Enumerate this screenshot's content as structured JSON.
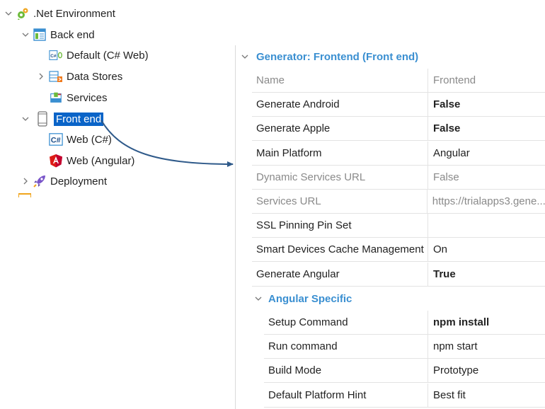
{
  "tree": {
    "root": {
      "label": ".Net Environment",
      "icon": "gears-icon"
    },
    "backend": {
      "label": "Back end",
      "icon": "window-app-icon"
    },
    "default_web": {
      "label": "Default (C# Web)",
      "icon": "csharp-web-icon"
    },
    "data_stores": {
      "label": "Data Stores",
      "icon": "data-stores-icon"
    },
    "services": {
      "label": "Services",
      "icon": "services-icon"
    },
    "frontend": {
      "label": "Front end",
      "icon": "mobile-device-icon"
    },
    "web_csharp": {
      "label": "Web (C#)",
      "icon": "csharp-icon"
    },
    "web_angular": {
      "label": "Web (Angular)",
      "icon": "angular-icon"
    },
    "deployment": {
      "label": "Deployment",
      "icon": "rocket-icon"
    }
  },
  "properties": {
    "category": "Generator: Frontend (Front end)",
    "rows": [
      {
        "name": "Name",
        "value": "Frontend",
        "disabled": true,
        "bold": false
      },
      {
        "name": "Generate Android",
        "value": "False",
        "disabled": false,
        "bold": true
      },
      {
        "name": "Generate Apple",
        "value": "False",
        "disabled": false,
        "bold": true
      },
      {
        "name": "Main Platform",
        "value": "Angular",
        "disabled": false,
        "bold": false
      },
      {
        "name": "Dynamic Services URL",
        "value": "False",
        "disabled": true,
        "bold": false
      },
      {
        "name": "Services URL",
        "value": "https://trialapps3.gene...",
        "disabled": true,
        "bold": false
      },
      {
        "name": "SSL Pinning Pin Set",
        "value": "",
        "disabled": false,
        "bold": false
      },
      {
        "name": "Smart Devices Cache Management",
        "value": "On",
        "disabled": false,
        "bold": false
      },
      {
        "name": "Generate Angular",
        "value": "True",
        "disabled": false,
        "bold": true
      }
    ],
    "subcategory": "Angular Specific",
    "subrows": [
      {
        "name": "Setup Command",
        "value": "npm install",
        "disabled": false,
        "bold": true
      },
      {
        "name": "Run command",
        "value": "npm start",
        "disabled": false,
        "bold": false
      },
      {
        "name": "Build Mode",
        "value": "Prototype",
        "disabled": false,
        "bold": false
      },
      {
        "name": "Default Platform Hint",
        "value": "Best fit",
        "disabled": false,
        "bold": false
      }
    ]
  },
  "colors": {
    "selection": "#0a64c8",
    "category": "#3a8fd1",
    "arrow": "#2f5a8a",
    "angular": "#dd1b16"
  }
}
